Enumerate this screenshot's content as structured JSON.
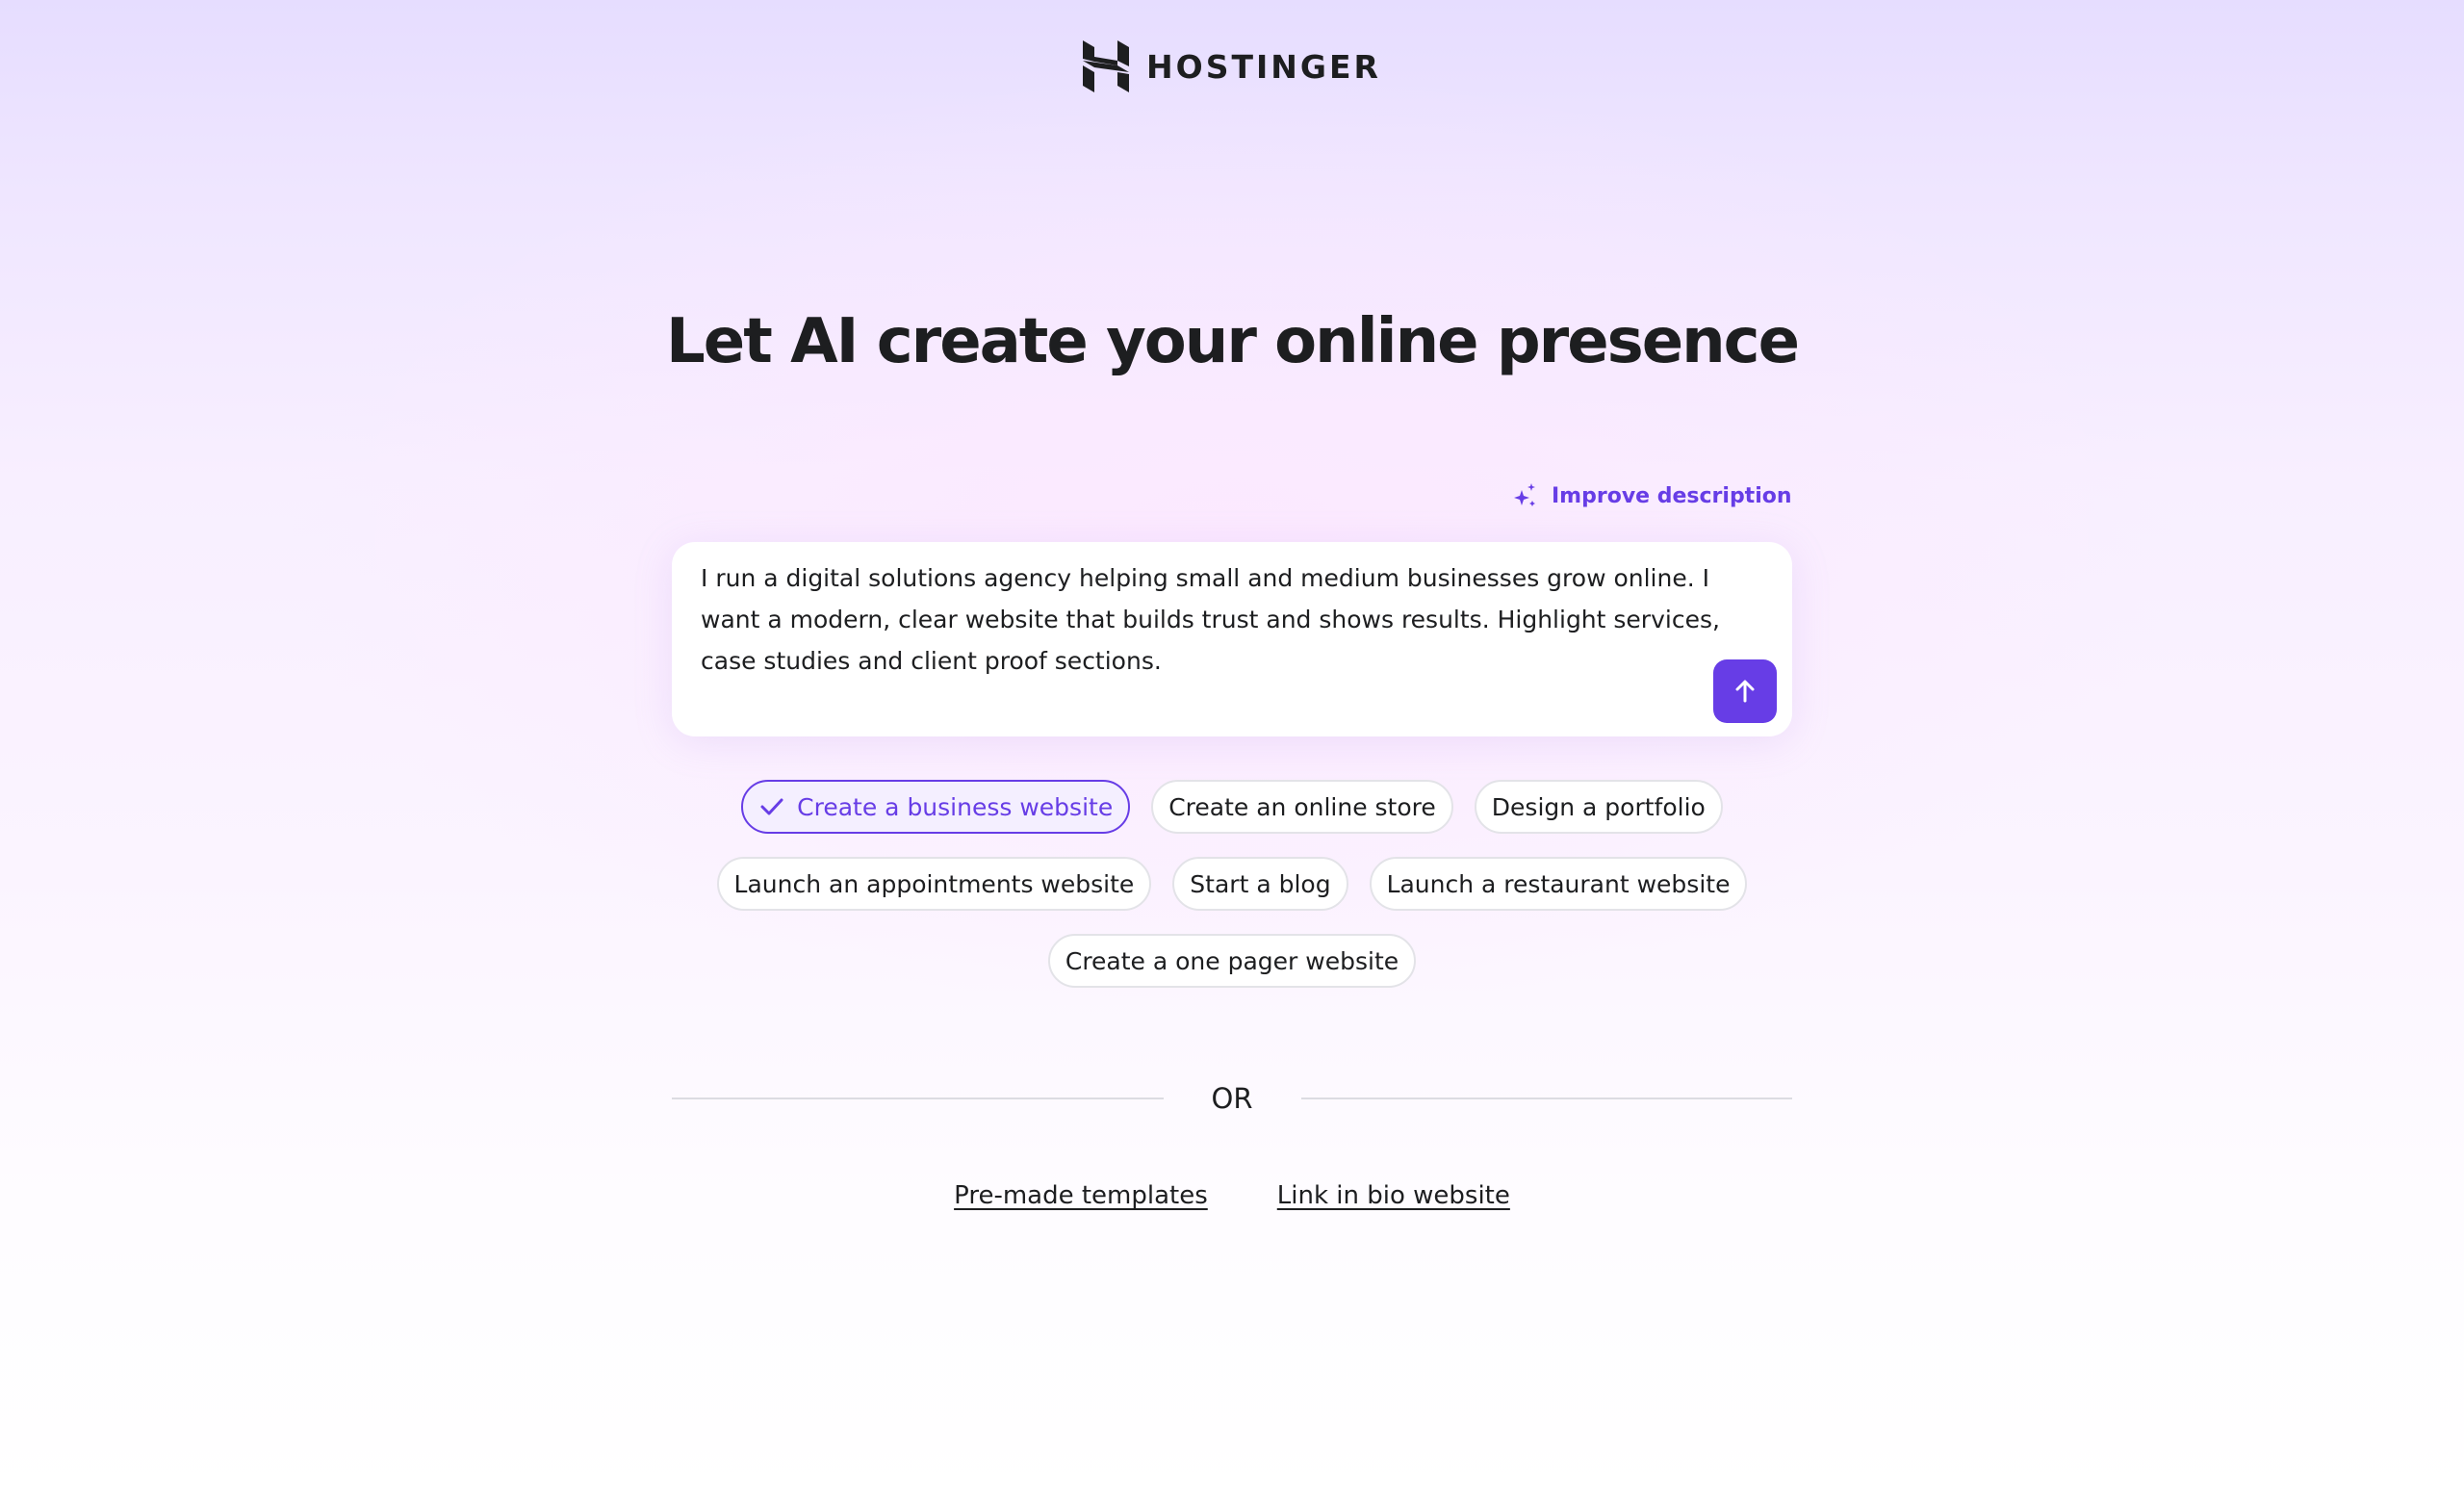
{
  "brand": {
    "name": "HOSTINGER",
    "logo_icon": "hostinger-h-logo",
    "accent_color": "#673de6"
  },
  "hero": {
    "title": "Let AI create your online presence"
  },
  "improve": {
    "label": "Improve description",
    "icon": "sparkles-icon"
  },
  "prompt": {
    "value": "I run a digital solutions agency helping small and medium businesses grow online. I want a modern, clear website that builds trust and shows results. Highlight services, case studies and client proof sections.",
    "send_icon": "arrow-up-icon"
  },
  "suggestions": {
    "rows": [
      [
        {
          "label": "Create a business website",
          "selected": true
        },
        {
          "label": "Create an online store",
          "selected": false
        },
        {
          "label": "Design a portfolio",
          "selected": false
        }
      ],
      [
        {
          "label": "Launch an appointments website",
          "selected": false
        },
        {
          "label": "Start a blog",
          "selected": false
        },
        {
          "label": "Launch a restaurant website",
          "selected": false
        }
      ],
      [
        {
          "label": "Create a one pager website",
          "selected": false
        }
      ]
    ]
  },
  "divider": {
    "label": "OR"
  },
  "links": {
    "templates": "Pre-made templates",
    "link_in_bio": "Link in bio website"
  }
}
